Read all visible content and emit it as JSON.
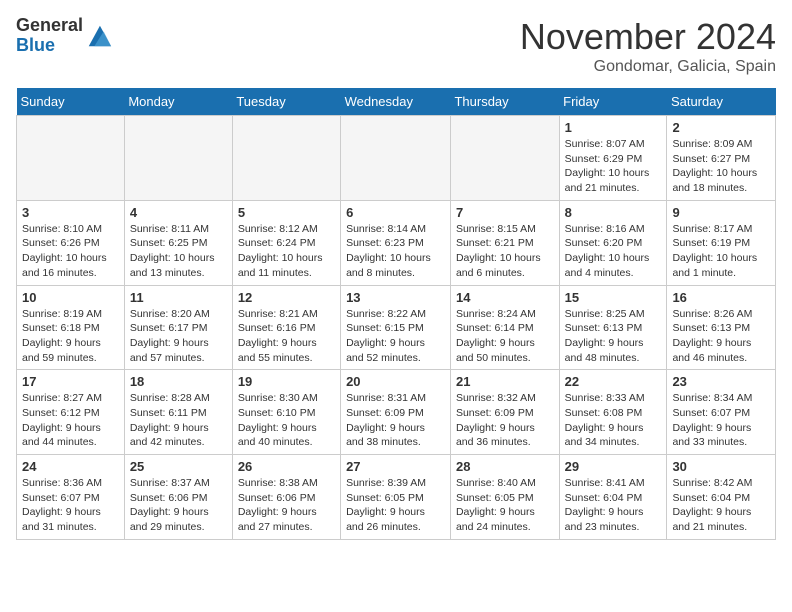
{
  "logo": {
    "general": "General",
    "blue": "Blue"
  },
  "title": "November 2024",
  "location": "Gondomar, Galicia, Spain",
  "weekdays": [
    "Sunday",
    "Monday",
    "Tuesday",
    "Wednesday",
    "Thursday",
    "Friday",
    "Saturday"
  ],
  "weeks": [
    [
      {
        "day": "",
        "info": ""
      },
      {
        "day": "",
        "info": ""
      },
      {
        "day": "",
        "info": ""
      },
      {
        "day": "",
        "info": ""
      },
      {
        "day": "",
        "info": ""
      },
      {
        "day": "1",
        "info": "Sunrise: 8:07 AM\nSunset: 6:29 PM\nDaylight: 10 hours and 21 minutes."
      },
      {
        "day": "2",
        "info": "Sunrise: 8:09 AM\nSunset: 6:27 PM\nDaylight: 10 hours and 18 minutes."
      }
    ],
    [
      {
        "day": "3",
        "info": "Sunrise: 8:10 AM\nSunset: 6:26 PM\nDaylight: 10 hours and 16 minutes."
      },
      {
        "day": "4",
        "info": "Sunrise: 8:11 AM\nSunset: 6:25 PM\nDaylight: 10 hours and 13 minutes."
      },
      {
        "day": "5",
        "info": "Sunrise: 8:12 AM\nSunset: 6:24 PM\nDaylight: 10 hours and 11 minutes."
      },
      {
        "day": "6",
        "info": "Sunrise: 8:14 AM\nSunset: 6:23 PM\nDaylight: 10 hours and 8 minutes."
      },
      {
        "day": "7",
        "info": "Sunrise: 8:15 AM\nSunset: 6:21 PM\nDaylight: 10 hours and 6 minutes."
      },
      {
        "day": "8",
        "info": "Sunrise: 8:16 AM\nSunset: 6:20 PM\nDaylight: 10 hours and 4 minutes."
      },
      {
        "day": "9",
        "info": "Sunrise: 8:17 AM\nSunset: 6:19 PM\nDaylight: 10 hours and 1 minute."
      }
    ],
    [
      {
        "day": "10",
        "info": "Sunrise: 8:19 AM\nSunset: 6:18 PM\nDaylight: 9 hours and 59 minutes."
      },
      {
        "day": "11",
        "info": "Sunrise: 8:20 AM\nSunset: 6:17 PM\nDaylight: 9 hours and 57 minutes."
      },
      {
        "day": "12",
        "info": "Sunrise: 8:21 AM\nSunset: 6:16 PM\nDaylight: 9 hours and 55 minutes."
      },
      {
        "day": "13",
        "info": "Sunrise: 8:22 AM\nSunset: 6:15 PM\nDaylight: 9 hours and 52 minutes."
      },
      {
        "day": "14",
        "info": "Sunrise: 8:24 AM\nSunset: 6:14 PM\nDaylight: 9 hours and 50 minutes."
      },
      {
        "day": "15",
        "info": "Sunrise: 8:25 AM\nSunset: 6:13 PM\nDaylight: 9 hours and 48 minutes."
      },
      {
        "day": "16",
        "info": "Sunrise: 8:26 AM\nSunset: 6:13 PM\nDaylight: 9 hours and 46 minutes."
      }
    ],
    [
      {
        "day": "17",
        "info": "Sunrise: 8:27 AM\nSunset: 6:12 PM\nDaylight: 9 hours and 44 minutes."
      },
      {
        "day": "18",
        "info": "Sunrise: 8:28 AM\nSunset: 6:11 PM\nDaylight: 9 hours and 42 minutes."
      },
      {
        "day": "19",
        "info": "Sunrise: 8:30 AM\nSunset: 6:10 PM\nDaylight: 9 hours and 40 minutes."
      },
      {
        "day": "20",
        "info": "Sunrise: 8:31 AM\nSunset: 6:09 PM\nDaylight: 9 hours and 38 minutes."
      },
      {
        "day": "21",
        "info": "Sunrise: 8:32 AM\nSunset: 6:09 PM\nDaylight: 9 hours and 36 minutes."
      },
      {
        "day": "22",
        "info": "Sunrise: 8:33 AM\nSunset: 6:08 PM\nDaylight: 9 hours and 34 minutes."
      },
      {
        "day": "23",
        "info": "Sunrise: 8:34 AM\nSunset: 6:07 PM\nDaylight: 9 hours and 33 minutes."
      }
    ],
    [
      {
        "day": "24",
        "info": "Sunrise: 8:36 AM\nSunset: 6:07 PM\nDaylight: 9 hours and 31 minutes."
      },
      {
        "day": "25",
        "info": "Sunrise: 8:37 AM\nSunset: 6:06 PM\nDaylight: 9 hours and 29 minutes."
      },
      {
        "day": "26",
        "info": "Sunrise: 8:38 AM\nSunset: 6:06 PM\nDaylight: 9 hours and 27 minutes."
      },
      {
        "day": "27",
        "info": "Sunrise: 8:39 AM\nSunset: 6:05 PM\nDaylight: 9 hours and 26 minutes."
      },
      {
        "day": "28",
        "info": "Sunrise: 8:40 AM\nSunset: 6:05 PM\nDaylight: 9 hours and 24 minutes."
      },
      {
        "day": "29",
        "info": "Sunrise: 8:41 AM\nSunset: 6:04 PM\nDaylight: 9 hours and 23 minutes."
      },
      {
        "day": "30",
        "info": "Sunrise: 8:42 AM\nSunset: 6:04 PM\nDaylight: 9 hours and 21 minutes."
      }
    ]
  ]
}
